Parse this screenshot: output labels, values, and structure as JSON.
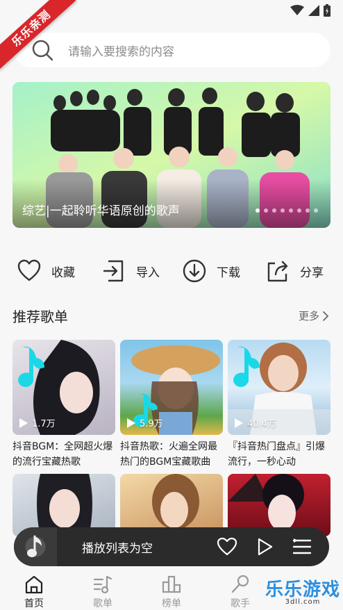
{
  "ribbon": {
    "text": "乐乐亲测"
  },
  "search": {
    "placeholder": "请输入要搜索的内容"
  },
  "banner": {
    "caption": "综艺|一起聆听华语原创的歌声",
    "dots": 8,
    "active_dot": 0
  },
  "actions": [
    {
      "label": "收藏",
      "icon": "heart-icon"
    },
    {
      "label": "导入",
      "icon": "import-icon"
    },
    {
      "label": "下载",
      "icon": "download-icon"
    },
    {
      "label": "分享",
      "icon": "share-icon"
    }
  ],
  "section": {
    "title": "推荐歌单",
    "more": "更多"
  },
  "playlists": [
    {
      "plays": "1.7万",
      "title": "抖音BGM：全网超火爆的流行宝藏热歌"
    },
    {
      "plays": "5.9万",
      "title": "抖音热歌：火遍全网最热门的BGM宝藏歌曲"
    },
    {
      "plays": "40.4万",
      "title": "『抖音热门盘点』引爆流行，一秒心动"
    }
  ],
  "player": {
    "empty_text": "播放列表为空"
  },
  "nav": [
    {
      "label": "首页",
      "icon": "home-icon",
      "active": true
    },
    {
      "label": "歌单",
      "icon": "playlist-icon",
      "active": false
    },
    {
      "label": "榜单",
      "icon": "chart-icon",
      "active": false
    },
    {
      "label": "歌手",
      "icon": "microphone-icon",
      "active": false
    }
  ],
  "watermark": {
    "text": "乐乐游戏",
    "sub": "3dll.com"
  },
  "colors": {
    "ribbon": "#d8262a",
    "player_bg": "#2b2b2b",
    "accent_green": "#7fe3c4"
  }
}
